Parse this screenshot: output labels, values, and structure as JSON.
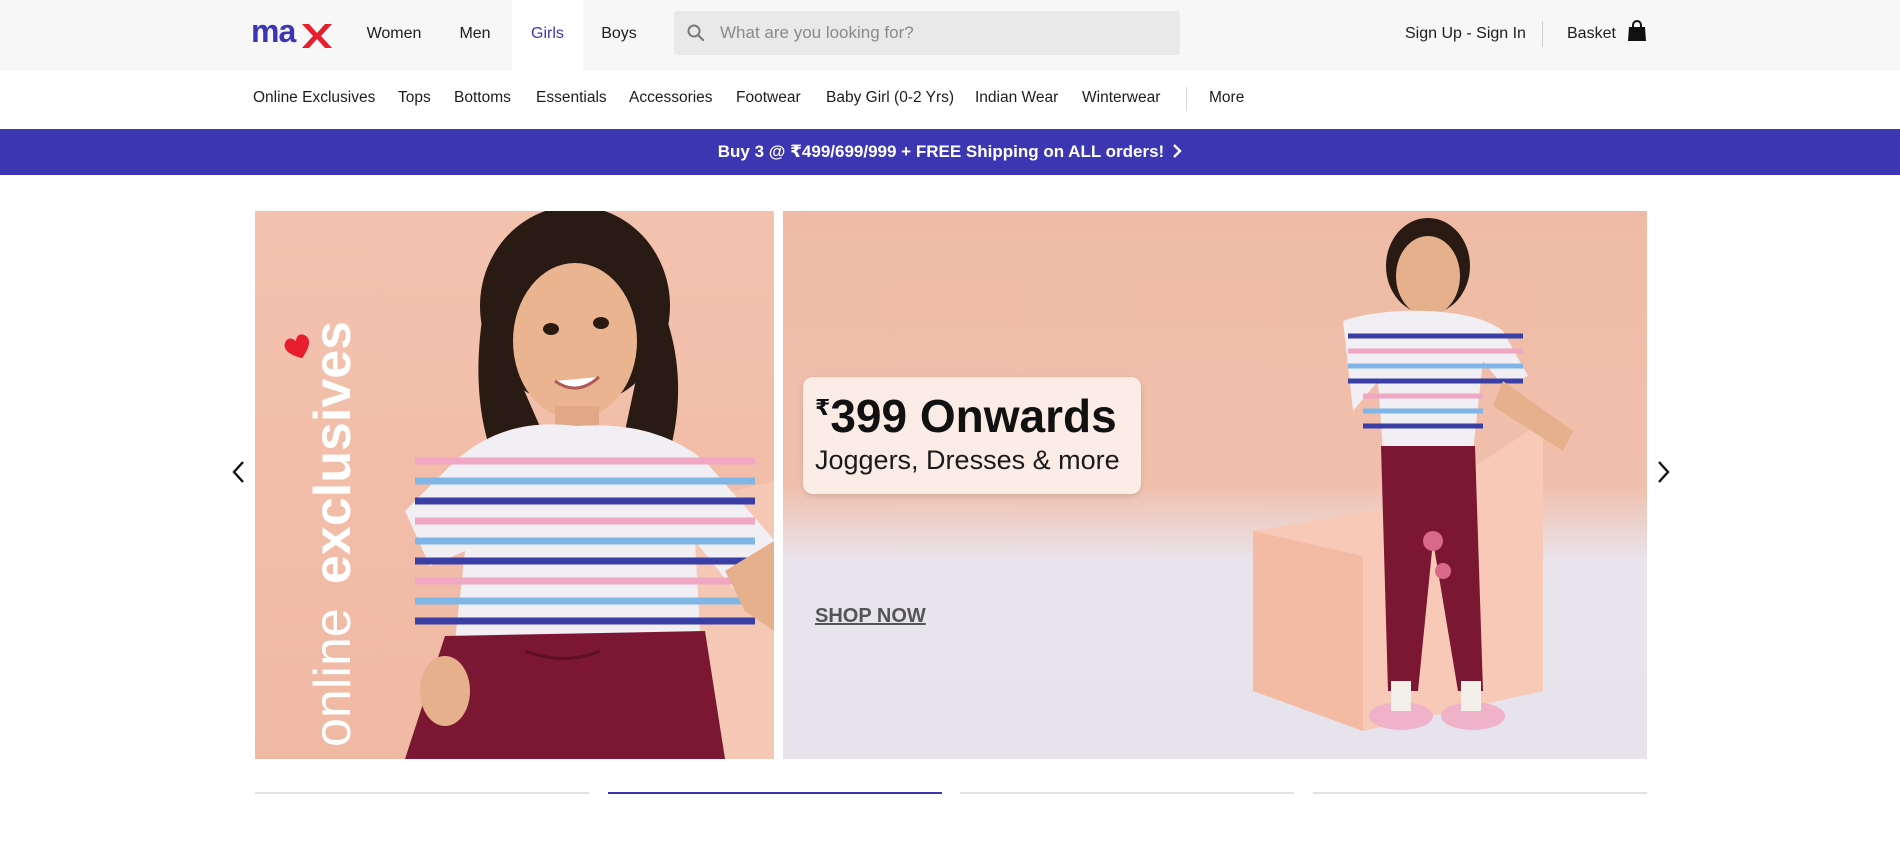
{
  "brand": {
    "logo_text": "max",
    "logo_color": "#3d36b4",
    "heart_color": "#e61e2e"
  },
  "header": {
    "departments": [
      {
        "label": "Women",
        "active": false
      },
      {
        "label": "Men",
        "active": false
      },
      {
        "label": "Girls",
        "active": true
      },
      {
        "label": "Boys",
        "active": false
      }
    ],
    "search": {
      "placeholder": "What are you looking for?",
      "value": "",
      "icon": "search-icon"
    },
    "signin_label": "Sign Up - Sign In",
    "basket_label": "Basket",
    "basket_icon": "shopping-bag-icon"
  },
  "category_nav": {
    "items": [
      "Online Exclusives",
      "Tops",
      "Bottoms",
      "Essentials",
      "Accessories",
      "Footwear",
      "Baby Girl (0-2 Yrs)",
      "Indian Wear",
      "Winterwear"
    ],
    "more_label": "More"
  },
  "promo": {
    "text": "Buy 3 @ ₹499/699/999 + FREE Shipping on ALL orders!",
    "icon": "chevron-right-icon",
    "bg_color": "#3c36b3"
  },
  "banner": {
    "vertical_text_light": "online",
    "vertical_text_bold": "exclusives",
    "price_symbol": "₹",
    "price_text": "399 Onwards",
    "subtitle": "Joggers, Dresses & more",
    "cta": "SHOP NOW",
    "slide_count": 4,
    "active_slide": 2,
    "prev_icon": "chevron-left-icon",
    "next_icon": "chevron-right-icon"
  }
}
